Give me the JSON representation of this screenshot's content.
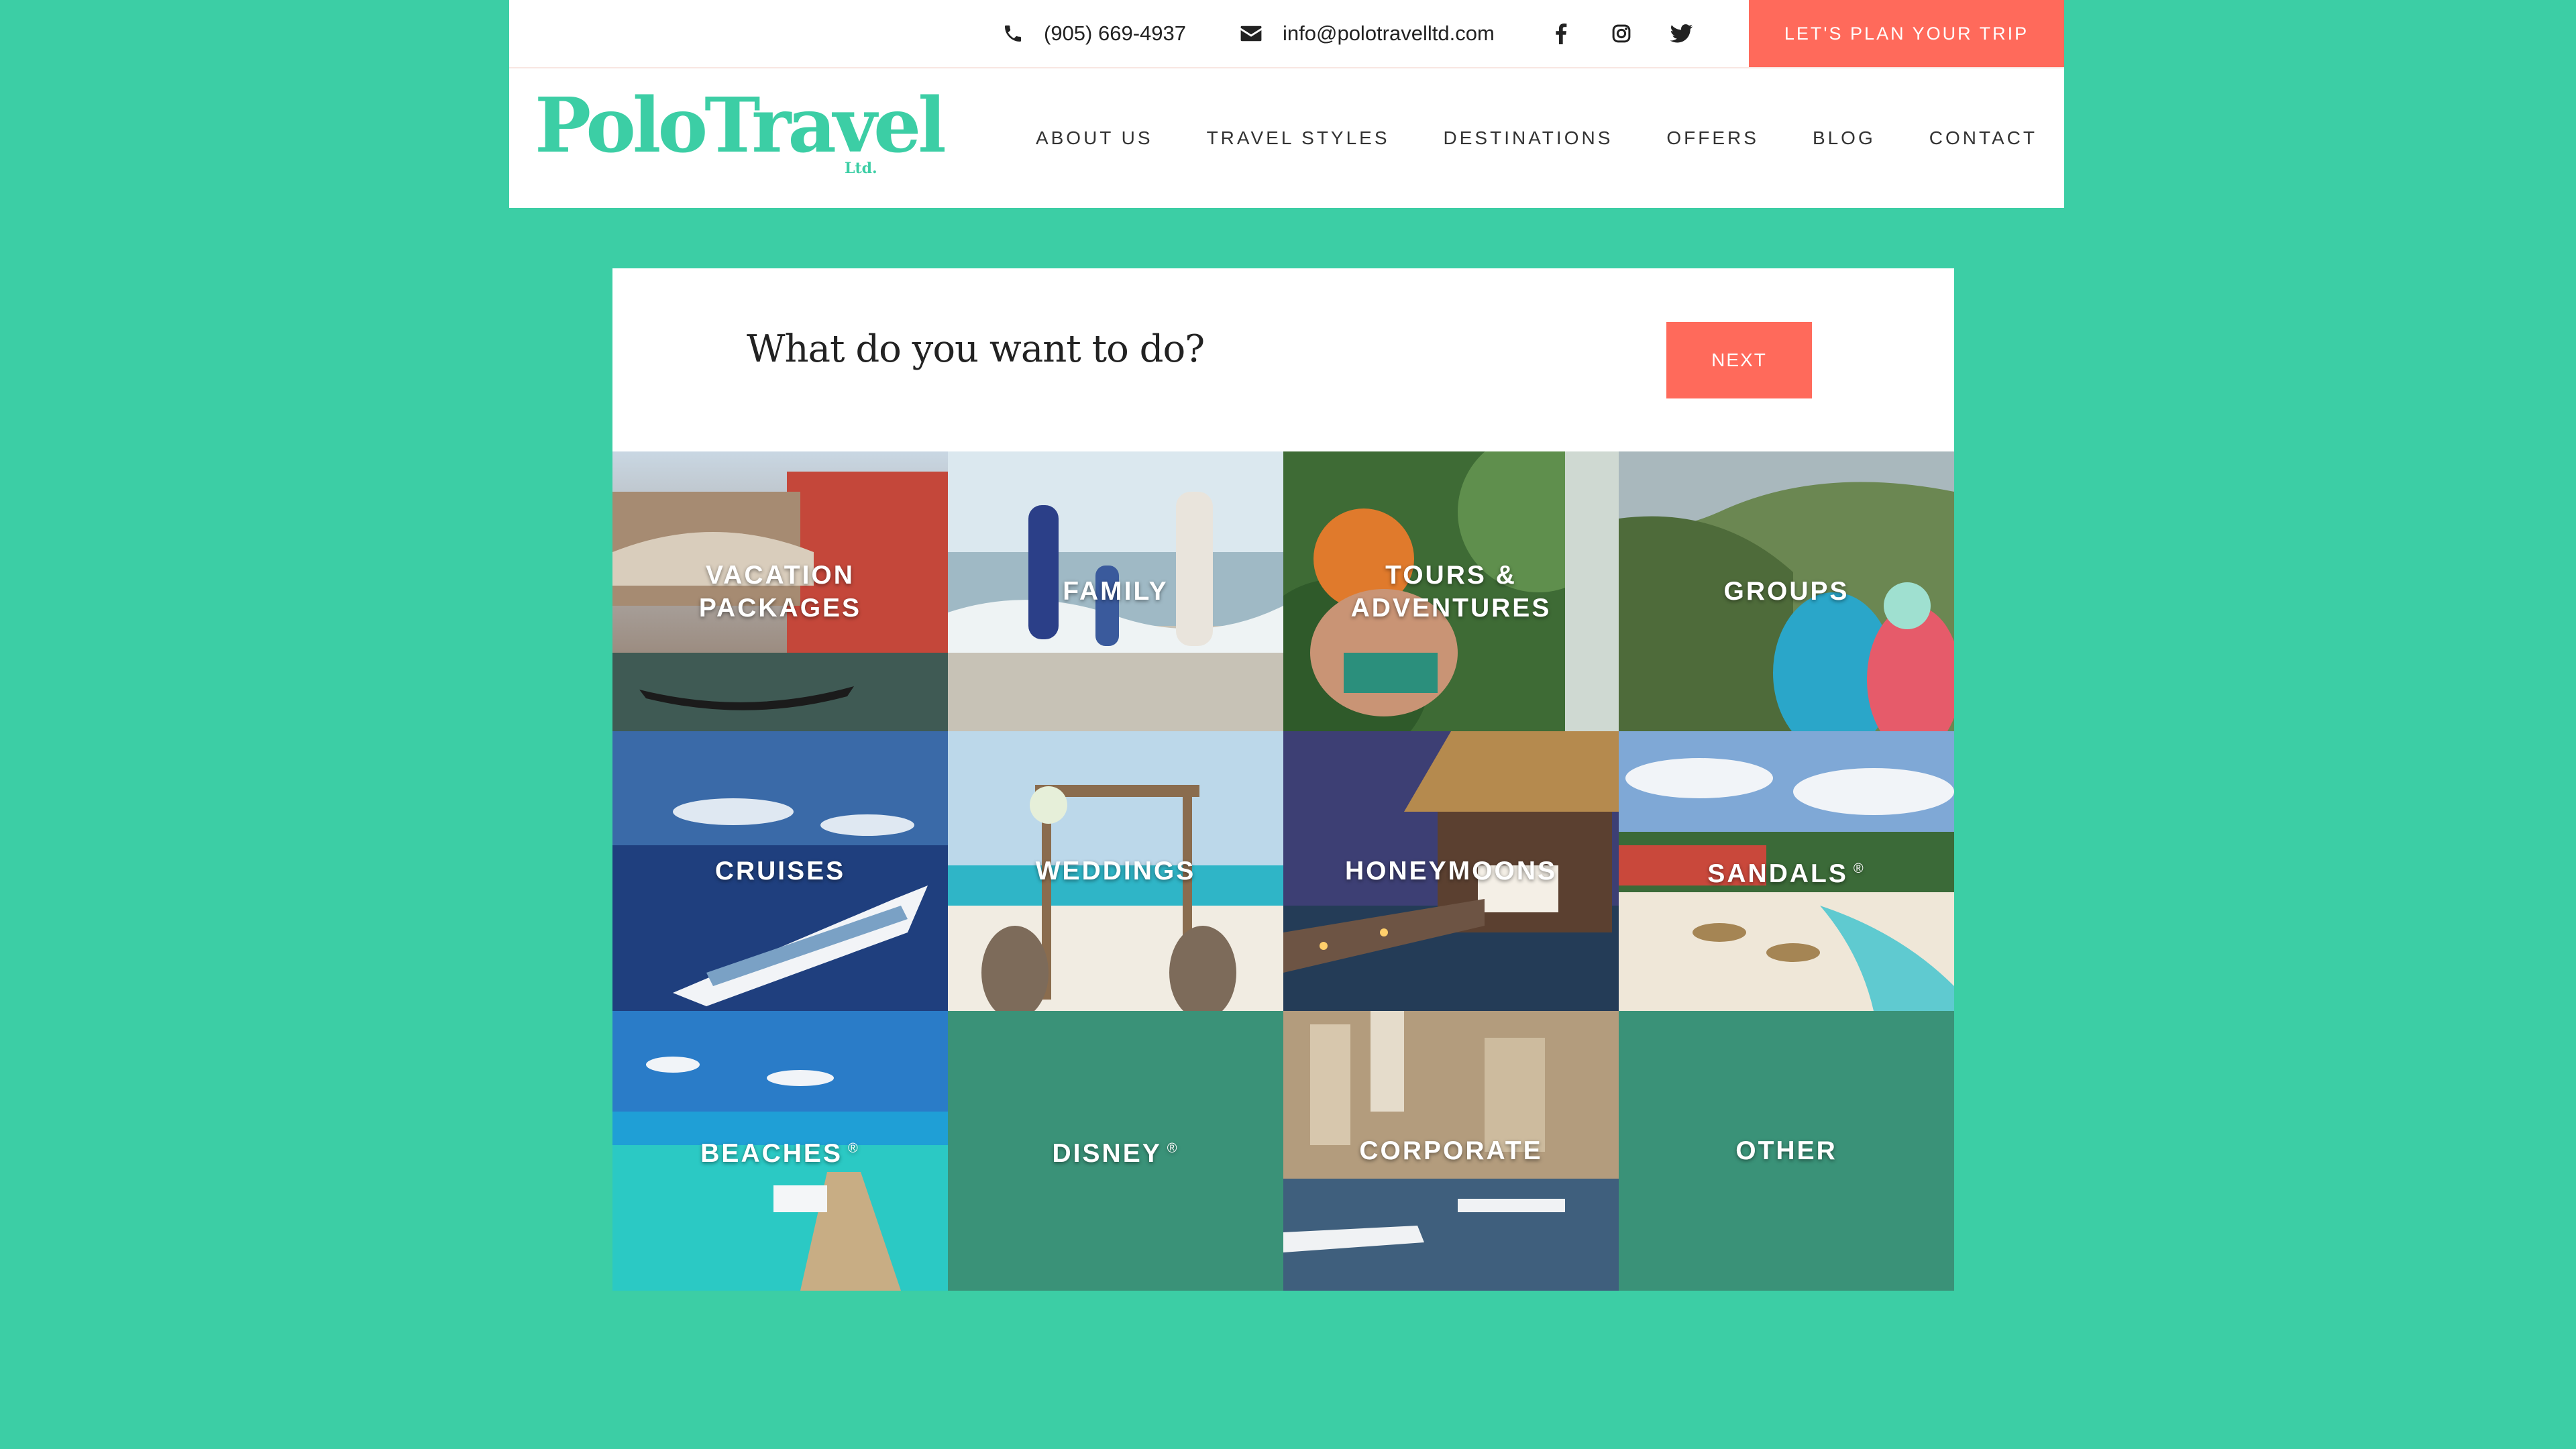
{
  "header": {
    "phone": "(905) 669-4937",
    "email": "info@polotravelltd.com",
    "social": [
      "facebook-icon",
      "instagram-icon",
      "twitter-icon"
    ],
    "plan_button": "LET'S PLAN YOUR TRIP"
  },
  "logo": {
    "name": "PoloTravel",
    "suffix": "Ltd."
  },
  "nav": [
    "ABOUT US",
    "TRAVEL STYLES",
    "DESTINATIONS",
    "OFFERS",
    "BLOG",
    "CONTACT"
  ],
  "card": {
    "question": "What do you want to do?",
    "next_button": "NEXT"
  },
  "tiles": [
    {
      "label": "VACATION\nPACKAGES"
    },
    {
      "label": "FAMILY"
    },
    {
      "label": "TOURS &\nADVENTURES"
    },
    {
      "label": "GROUPS"
    },
    {
      "label": "CRUISES"
    },
    {
      "label": "WEDDINGS"
    },
    {
      "label": "HONEYMOONS"
    },
    {
      "label": "SANDALS",
      "mark": "®"
    },
    {
      "label": "BEACHES",
      "mark": "®"
    },
    {
      "label": "DISNEY",
      "mark": "®"
    },
    {
      "label": "CORPORATE"
    },
    {
      "label": "OTHER"
    }
  ],
  "colors": {
    "background": "#3ccea5",
    "accent": "#ff6a5b",
    "tile_solid": "#3a9278",
    "logo": "#3ccea5"
  }
}
